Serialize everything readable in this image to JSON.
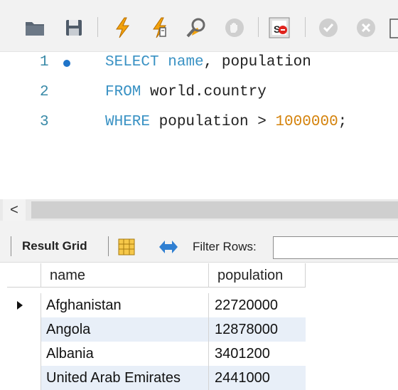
{
  "toolbar": {
    "buttons": [
      {
        "icon": "open-folder-icon"
      },
      {
        "icon": "save-icon"
      },
      {
        "icon": "execute-icon"
      },
      {
        "icon": "execute-current-statement-icon"
      },
      {
        "icon": "explain-icon"
      },
      {
        "icon": "stop-icon"
      },
      {
        "icon": "toggle-continue-on-error-icon"
      },
      {
        "icon": "commit-icon"
      },
      {
        "icon": "rollback-icon"
      }
    ]
  },
  "editor": {
    "lines": [
      {
        "number": "1",
        "keyword": "SELECT",
        "ident": "name",
        "rest": ", population"
      },
      {
        "number": "2",
        "keyword": "FROM",
        "rest": " world.country"
      },
      {
        "number": "3",
        "keyword": "WHERE",
        "rest": " population > ",
        "number_literal": "1000000",
        "tail": ";"
      }
    ]
  },
  "scrollbar": {
    "left_arrow": "<"
  },
  "results_toolbar": {
    "result_grid_label": "Result Grid",
    "filter_label": "Filter Rows:",
    "filter_value": ""
  },
  "grid": {
    "columns": [
      "name",
      "population"
    ],
    "rows": [
      [
        "Afghanistan",
        "22720000"
      ],
      [
        "Angola",
        "12878000"
      ],
      [
        "Albania",
        "3401200"
      ],
      [
        "United Arab Emirates",
        "2441000"
      ]
    ]
  },
  "colors": {
    "keyword": "#3a92c4",
    "number": "#d4820b",
    "line_number": "#3a8aa8",
    "row_alt": "#e8eff8"
  }
}
